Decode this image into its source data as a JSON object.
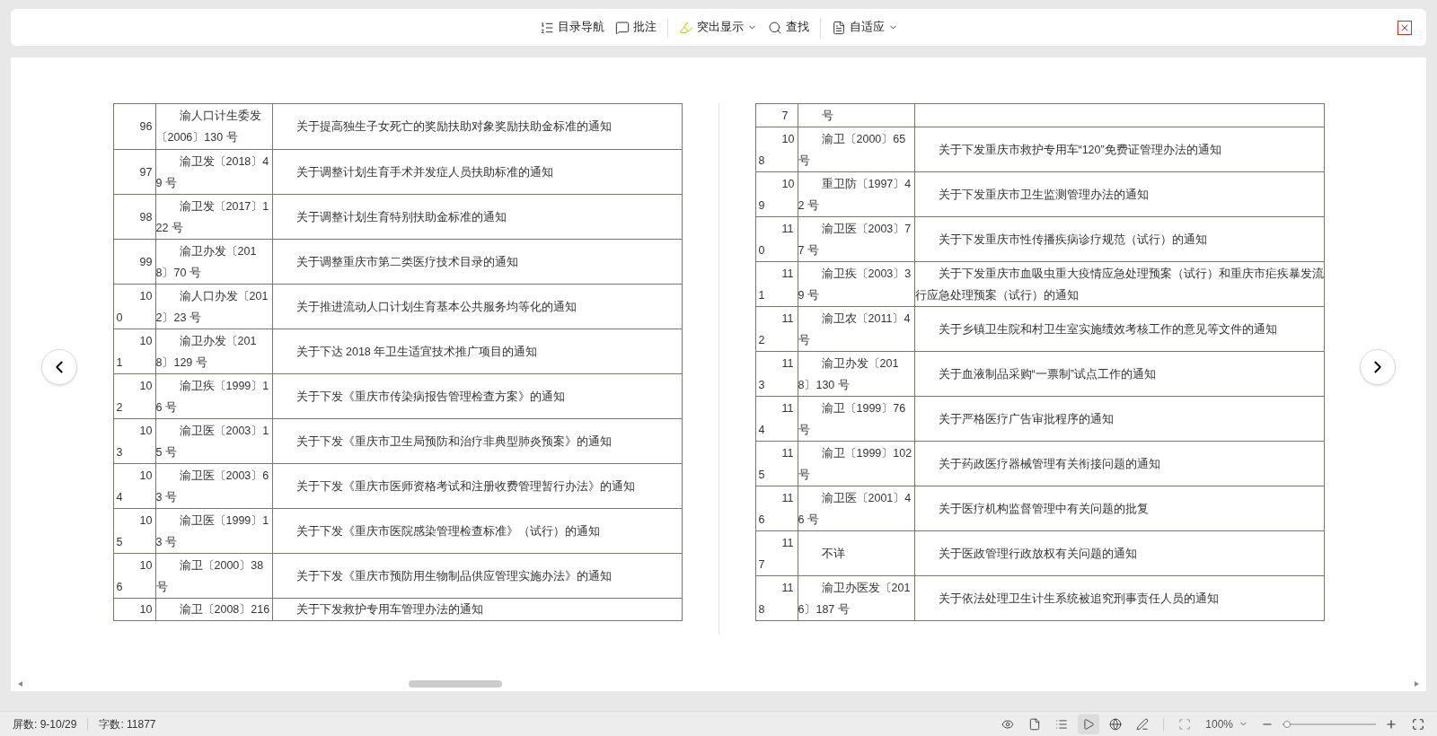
{
  "toolbar": {
    "items": [
      {
        "kind": "toc",
        "label": "目录导航",
        "caret": false
      },
      {
        "kind": "comment",
        "label": "批注",
        "caret": false
      },
      {
        "kind": "highlight",
        "label": "突出显示",
        "caret": true
      },
      {
        "kind": "find",
        "label": "查找",
        "caret": false
      },
      {
        "kind": "fit",
        "label": "自适应",
        "caret": true
      }
    ]
  },
  "pages": [
    {
      "rows": [
        {
          "number": "96",
          "doc": "渝人口计生委发〔2006〕130 号",
          "title": "关于提高独生子女死亡的奖励扶助对象奖励扶助金标准的通知"
        },
        {
          "number": "97",
          "doc": "渝卫发〔2018〕49 号",
          "title": "关于调整计划生育手术并发症人员扶助标准的通知"
        },
        {
          "number": "98",
          "doc": "渝卫发〔2017〕122 号",
          "title": "关于调整计划生育特别扶助金标准的通知"
        },
        {
          "number": "99",
          "doc": "渝卫办发〔2018〕70 号",
          "title": "关于调整重庆市第二类医疗技术目录的通知"
        },
        {
          "number": "100",
          "doc": "渝人口办发〔2012〕23 号",
          "title": "关于推进流动人口计划生育基本公共服务均等化的通知"
        },
        {
          "number": "101",
          "doc": "渝卫办发〔2018〕129 号",
          "title": "关于下达 2018 年卫生适宜技术推广项目的通知"
        },
        {
          "number": "102",
          "doc": "渝卫疾〔1999〕16 号",
          "title": "关于下发《重庆市传染病报告管理检查方案》的通知"
        },
        {
          "number": "103",
          "doc": "渝卫医〔2003〕15 号",
          "title": "关于下发《重庆市卫生局预防和治疗非典型肺炎预案》的通知"
        },
        {
          "number": "104",
          "doc": "渝卫医〔2003〕63 号",
          "title": "关于下发《重庆市医师资格考试和注册收费管理暂行办法》的通知"
        },
        {
          "number": "105",
          "doc": "渝卫医〔1999〕13 号",
          "title": "关于下发《重庆市医院感染管理检查标准》（试行）的通知"
        },
        {
          "number": "106",
          "doc": "渝卫〔2000〕38 号",
          "title": "关于下发《重庆市预防用生物制品供应管理实施办法》的通知"
        },
        {
          "number": "10",
          "doc": "渝卫〔2008〕216",
          "title": "关于下发救护专用车管理办法的通知",
          "cut": true
        }
      ]
    },
    {
      "rows": [
        {
          "number": "7",
          "doc": "号",
          "cut": true
        },
        {
          "number": "108",
          "doc": "渝卫〔2000〕65 号",
          "title": "关于下发重庆市救护专用车“120”免费证管理办法的通知"
        },
        {
          "number": "109",
          "doc": "重卫防〔1997〕42 号",
          "title": "关于下发重庆市卫生监测管理办法的通知"
        },
        {
          "number": "110",
          "doc": "渝卫医〔2003〕77 号",
          "title": "关于下发重庆市性传播疾病诊疗规范（试行）的通知"
        },
        {
          "number": "111",
          "doc": "渝卫疾〔2003〕39 号",
          "title": "关于下发重庆市血吸虫重大疫情应急处理预案（试行）和重庆市疟疾暴发流行应急处理预案（试行）的通知"
        },
        {
          "number": "112",
          "doc": "渝卫农〔2011〕4 号",
          "title": "关于乡镇卫生院和村卫生室实施绩效考核工作的意见等文件的通知"
        },
        {
          "number": "113",
          "doc": "渝卫办发〔2018〕130 号",
          "title": "关于血液制品采购“一票制”试点工作的通知"
        },
        {
          "number": "114",
          "doc": "渝卫〔1999〕76 号",
          "title": "关于严格医疗广告审批程序的通知"
        },
        {
          "number": "115",
          "doc": "渝卫〔1999〕102 号",
          "title": "关于药政医疗器械管理有关衔接问题的通知"
        },
        {
          "number": "116",
          "doc": "渝卫医〔2001〕46 号",
          "title": "关于医疗机构监督管理中有关问题的批复"
        },
        {
          "number": "117",
          "doc": "不详",
          "title": "关于医政管理行政放权有关问题的通知"
        },
        {
          "number": "118",
          "doc": "渝卫办医发〔2016〕187 号",
          "title": "关于依法处理卫生计生系统被追究刑事责任人员的通知"
        }
      ]
    }
  ],
  "status_bar": {
    "screens": "屏数: 9-10/29",
    "words": "字数: 11877",
    "views": [
      {
        "kind": "eye",
        "selected": false
      },
      {
        "kind": "page",
        "selected": false
      },
      {
        "kind": "outline",
        "selected": false
      },
      {
        "kind": "play",
        "selected": true
      },
      {
        "kind": "web",
        "selected": false
      },
      {
        "kind": "pen",
        "selected": false
      }
    ],
    "zoom": "100%",
    "zoom_level": {
      "level": 0.05
    }
  }
}
